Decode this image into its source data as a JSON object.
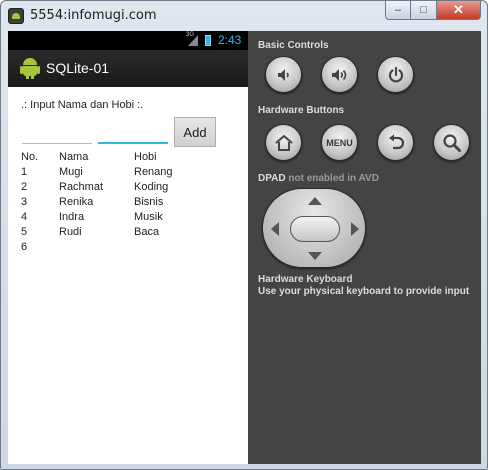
{
  "window": {
    "title": "5554:infomugi.com",
    "minimize_label": "–",
    "maximize_label": "□",
    "close_label": "✕"
  },
  "device": {
    "status_bar": {
      "network_label": "3G",
      "time": "2:43"
    },
    "action_bar": {
      "app_title": "SQLite-01"
    },
    "form": {
      "prompt": ".: Input Nama dan Hobi :.",
      "nama_value": "",
      "hobi_value": "",
      "add_button_label": "Add"
    },
    "table": {
      "headers": {
        "no": "No.",
        "nama": "Nama",
        "hobi": "Hobi"
      },
      "rows": [
        {
          "no": "1",
          "nama": "Mugi",
          "hobi": "Renang"
        },
        {
          "no": "2",
          "nama": "Rachmat",
          "hobi": "Koding"
        },
        {
          "no": "3",
          "nama": "Renika",
          "hobi": "Bisnis"
        },
        {
          "no": "4",
          "nama": "Indra",
          "hobi": "Musik"
        },
        {
          "no": "5",
          "nama": "Rudi",
          "hobi": "Baca"
        },
        {
          "no": "6",
          "nama": "",
          "hobi": ""
        }
      ]
    }
  },
  "controls": {
    "basic_controls_title": "Basic Controls",
    "hardware_buttons_title": "Hardware Buttons",
    "menu_button_label": "MENU",
    "dpad_title": "DPAD",
    "dpad_status": "not enabled in AVD",
    "keyboard_title": "Hardware Keyboard",
    "keyboard_hint": "Use your physical keyboard to provide input"
  },
  "colors": {
    "accent": "#33b5e5",
    "android_green": "#a4c639",
    "panel_bg": "#444444",
    "action_bar_bg": "#1f1f1f"
  }
}
